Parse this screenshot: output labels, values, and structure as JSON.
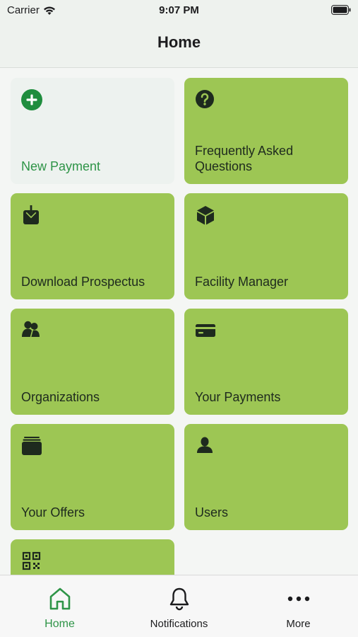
{
  "status": {
    "carrier": "Carrier",
    "time": "9:07 PM"
  },
  "nav": {
    "title": "Home"
  },
  "tiles": [
    {
      "label": "New Payment",
      "icon": "plus-circle-icon",
      "style": "light"
    },
    {
      "label": "Frequently Asked Questions",
      "icon": "question-circle-icon"
    },
    {
      "label": "Download Prospectus",
      "icon": "download-box-icon"
    },
    {
      "label": "Facility Manager",
      "icon": "cube-icon"
    },
    {
      "label": "Organizations",
      "icon": "people-icon"
    },
    {
      "label": "Your Payments",
      "icon": "credit-card-icon"
    },
    {
      "label": "Your Offers",
      "icon": "wallet-icon"
    },
    {
      "label": "Users",
      "icon": "person-icon"
    },
    {
      "label": "",
      "icon": "qr-code-icon"
    }
  ],
  "tabs": [
    {
      "label": "Home",
      "icon": "home-icon",
      "active": true
    },
    {
      "label": "Notifications",
      "icon": "bell-icon"
    },
    {
      "label": "More",
      "icon": "more-dots-icon"
    }
  ],
  "colors": {
    "tile": "#9dc654",
    "tile_light": "#edf2ef",
    "accent": "#2e9447"
  }
}
